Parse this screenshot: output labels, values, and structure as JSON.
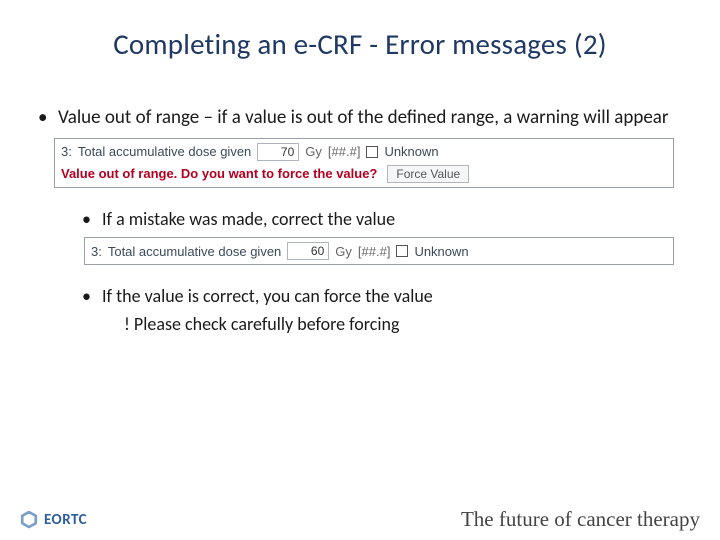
{
  "title": "Completing an e-CRF - Error messages (2)",
  "bullet1": "Value out of range – if a value is out of the defined range, a warning will appear",
  "crf1": {
    "question_no": "3:",
    "label": "Total accumulative dose given",
    "value": "70",
    "unit": "Gy",
    "format": "[##.#]",
    "unknown_label": "Unknown",
    "warning": "Value out of range. Do you want to force the value?",
    "force_label": "Force Value"
  },
  "sub1": "If a mistake was made, correct the value",
  "crf2": {
    "question_no": "3:",
    "label": "Total accumulative dose given",
    "value": "60",
    "unit": "Gy",
    "format": "[##.#]",
    "unknown_label": "Unknown"
  },
  "sub2": "If the value is correct, you can force the value",
  "sub2_note": "! Please check carefully before forcing",
  "footer": {
    "org": "EORTC",
    "tagline": "The future of cancer therapy"
  }
}
